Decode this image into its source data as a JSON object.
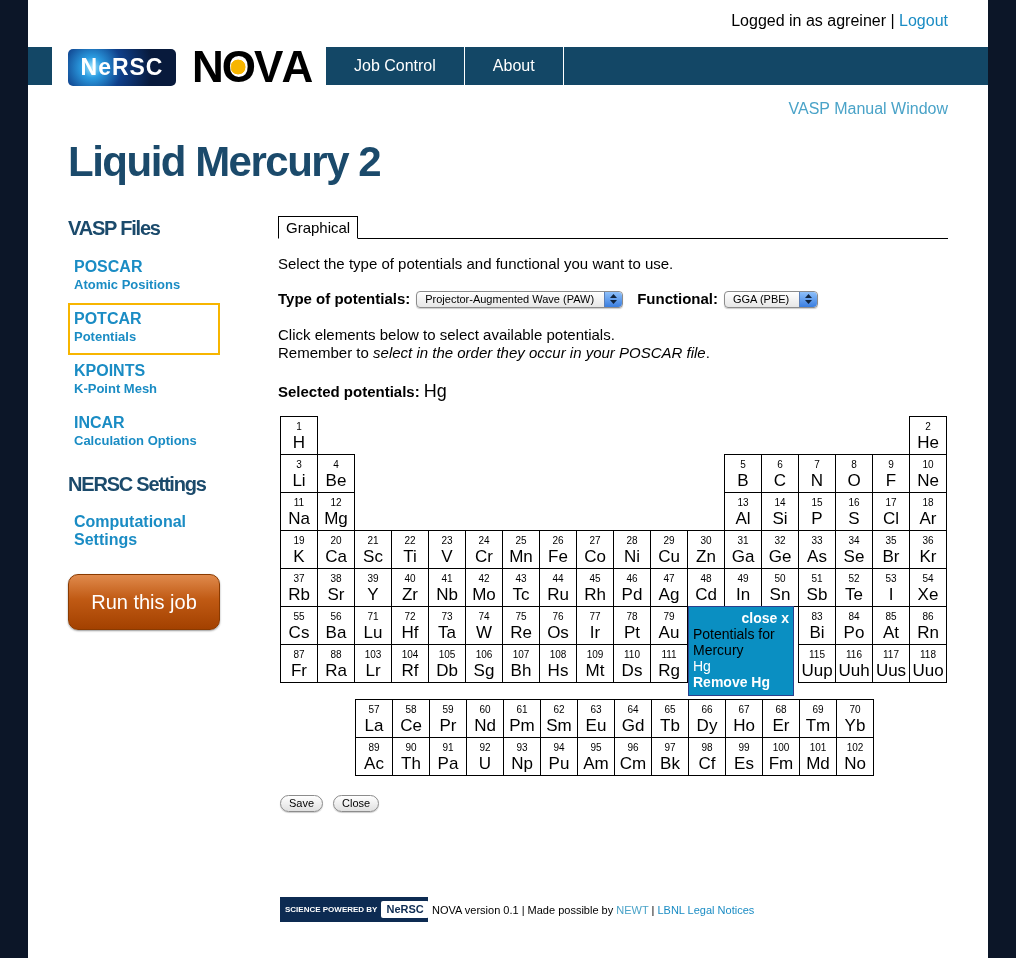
{
  "header": {
    "login_text": "Logged in as agreiner |",
    "logout": {
      "label": "Logout",
      "visited": false
    }
  },
  "logos": {
    "nersc": "NeRSC",
    "nova": "NOVA"
  },
  "nav": {
    "items": [
      {
        "label": "Job Control"
      },
      {
        "label": "About"
      }
    ]
  },
  "manual_link": {
    "label": "VASP Manual Window",
    "visited": true
  },
  "page_title": "Liquid Mercury 2",
  "sidebar": {
    "sections": [
      {
        "heading": "VASP Files",
        "items": [
          {
            "title": "POSCAR",
            "subtitle": "Atomic Positions",
            "selected": false
          },
          {
            "title": "POTCAR",
            "subtitle": "Potentials",
            "selected": true
          },
          {
            "title": "KPOINTS",
            "subtitle": "K-Point Mesh",
            "selected": false
          },
          {
            "title": "INCAR",
            "subtitle": "Calculation Options",
            "selected": false
          }
        ]
      },
      {
        "heading": "NERSC Settings",
        "items": [
          {
            "title": "Computational Settings",
            "selected": false
          }
        ]
      }
    ],
    "run_button": "Run this job"
  },
  "tabs": [
    {
      "label": "Graphical",
      "selected": true
    }
  ],
  "intro": "Select the type of potentials and functional you want to use.",
  "selects": [
    {
      "label": "Type of potentials:",
      "value": "Projector-Augmented Wave (PAW)"
    },
    {
      "label": "Functional:",
      "value": "GGA (PBE)"
    }
  ],
  "instructions": [
    "Click elements below to select available potentials.",
    "Remember to *select in the order they occur in your POSCAR file*."
  ],
  "selected_potentials": {
    "label": "Selected potentials:",
    "value": "Hg"
  },
  "periodic_table": {
    "main_rows": [
      [
        {
          "number": "1",
          "symbol": "H"
        },
        null,
        null,
        null,
        null,
        null,
        null,
        null,
        null,
        null,
        null,
        null,
        null,
        null,
        null,
        null,
        null,
        {
          "number": "2",
          "symbol": "He"
        }
      ],
      [
        {
          "number": "3",
          "symbol": "Li"
        },
        {
          "number": "4",
          "symbol": "Be"
        },
        null,
        null,
        null,
        null,
        null,
        null,
        null,
        null,
        null,
        null,
        {
          "number": "5",
          "symbol": "B"
        },
        {
          "number": "6",
          "symbol": "C"
        },
        {
          "number": "7",
          "symbol": "N"
        },
        {
          "number": "8",
          "symbol": "O"
        },
        {
          "number": "9",
          "symbol": "F"
        },
        {
          "number": "10",
          "symbol": "Ne"
        }
      ],
      [
        {
          "number": "11",
          "symbol": "Na"
        },
        {
          "number": "12",
          "symbol": "Mg"
        },
        null,
        null,
        null,
        null,
        null,
        null,
        null,
        null,
        null,
        null,
        {
          "number": "13",
          "symbol": "Al"
        },
        {
          "number": "14",
          "symbol": "Si"
        },
        {
          "number": "15",
          "symbol": "P"
        },
        {
          "number": "16",
          "symbol": "S"
        },
        {
          "number": "17",
          "symbol": "Cl"
        },
        {
          "number": "18",
          "symbol": "Ar"
        }
      ],
      [
        {
          "number": "19",
          "symbol": "K"
        },
        {
          "number": "20",
          "symbol": "Ca"
        },
        {
          "number": "21",
          "symbol": "Sc"
        },
        {
          "number": "22",
          "symbol": "Ti"
        },
        {
          "number": "23",
          "symbol": "V"
        },
        {
          "number": "24",
          "symbol": "Cr"
        },
        {
          "number": "25",
          "symbol": "Mn"
        },
        {
          "number": "26",
          "symbol": "Fe"
        },
        {
          "number": "27",
          "symbol": "Co"
        },
        {
          "number": "28",
          "symbol": "Ni"
        },
        {
          "number": "29",
          "symbol": "Cu"
        },
        {
          "number": "30",
          "symbol": "Zn"
        },
        {
          "number": "31",
          "symbol": "Ga"
        },
        {
          "number": "32",
          "symbol": "Ge"
        },
        {
          "number": "33",
          "symbol": "As"
        },
        {
          "number": "34",
          "symbol": "Se"
        },
        {
          "number": "35",
          "symbol": "Br"
        },
        {
          "number": "36",
          "symbol": "Kr"
        }
      ],
      [
        {
          "number": "37",
          "symbol": "Rb"
        },
        {
          "number": "38",
          "symbol": "Sr"
        },
        {
          "number": "39",
          "symbol": "Y"
        },
        {
          "number": "40",
          "symbol": "Zr"
        },
        {
          "number": "41",
          "symbol": "Nb"
        },
        {
          "number": "42",
          "symbol": "Mo"
        },
        {
          "number": "43",
          "symbol": "Tc"
        },
        {
          "number": "44",
          "symbol": "Ru"
        },
        {
          "number": "45",
          "symbol": "Rh"
        },
        {
          "number": "46",
          "symbol": "Pd"
        },
        {
          "number": "47",
          "symbol": "Ag"
        },
        {
          "number": "48",
          "symbol": "Cd"
        },
        {
          "number": "49",
          "symbol": "In"
        },
        {
          "number": "50",
          "symbol": "Sn"
        },
        {
          "number": "51",
          "symbol": "Sb"
        },
        {
          "number": "52",
          "symbol": "Te"
        },
        {
          "number": "53",
          "symbol": "I"
        },
        {
          "number": "54",
          "symbol": "Xe"
        }
      ],
      [
        {
          "number": "55",
          "symbol": "Cs"
        },
        {
          "number": "56",
          "symbol": "Ba"
        },
        {
          "number": "71",
          "symbol": "Lu"
        },
        {
          "number": "72",
          "symbol": "Hf"
        },
        {
          "number": "73",
          "symbol": "Ta"
        },
        {
          "number": "74",
          "symbol": "W"
        },
        {
          "number": "75",
          "symbol": "Re"
        },
        {
          "number": "76",
          "symbol": "Os"
        },
        {
          "number": "77",
          "symbol": "Ir"
        },
        {
          "number": "78",
          "symbol": "Pt"
        },
        {
          "number": "79",
          "symbol": "Au"
        },
        null,
        null,
        null,
        {
          "number": "83",
          "symbol": "Bi"
        },
        {
          "number": "84",
          "symbol": "Po"
        },
        {
          "number": "85",
          "symbol": "At"
        },
        {
          "number": "86",
          "symbol": "Rn"
        }
      ],
      [
        {
          "number": "87",
          "symbol": "Fr"
        },
        {
          "number": "88",
          "symbol": "Ra"
        },
        {
          "number": "103",
          "symbol": "Lr"
        },
        {
          "number": "104",
          "symbol": "Rf"
        },
        {
          "number": "105",
          "symbol": "Db"
        },
        {
          "number": "106",
          "symbol": "Sg"
        },
        {
          "number": "107",
          "symbol": "Bh"
        },
        {
          "number": "108",
          "symbol": "Hs"
        },
        {
          "number": "109",
          "symbol": "Mt"
        },
        {
          "number": "110",
          "symbol": "Ds"
        },
        {
          "number": "111",
          "symbol": "Rg"
        },
        null,
        null,
        null,
        {
          "number": "115",
          "symbol": "Uup"
        },
        {
          "number": "116",
          "symbol": "Uuh"
        },
        {
          "number": "117",
          "symbol": "Uus"
        },
        {
          "number": "118",
          "symbol": "Uuo"
        }
      ]
    ],
    "f_block_rows": [
      [
        {
          "number": "57",
          "symbol": "La"
        },
        {
          "number": "58",
          "symbol": "Ce"
        },
        {
          "number": "59",
          "symbol": "Pr"
        },
        {
          "number": "60",
          "symbol": "Nd"
        },
        {
          "number": "61",
          "symbol": "Pm"
        },
        {
          "number": "62",
          "symbol": "Sm"
        },
        {
          "number": "63",
          "symbol": "Eu"
        },
        {
          "number": "64",
          "symbol": "Gd"
        },
        {
          "number": "65",
          "symbol": "Tb"
        },
        {
          "number": "66",
          "symbol": "Dy"
        },
        {
          "number": "67",
          "symbol": "Ho"
        },
        {
          "number": "68",
          "symbol": "Er"
        },
        {
          "number": "69",
          "symbol": "Tm"
        },
        {
          "number": "70",
          "symbol": "Yb"
        }
      ],
      [
        {
          "number": "89",
          "symbol": "Ac"
        },
        {
          "number": "90",
          "symbol": "Th"
        },
        {
          "number": "91",
          "symbol": "Pa"
        },
        {
          "number": "92",
          "symbol": "U"
        },
        {
          "number": "93",
          "symbol": "Np"
        },
        {
          "number": "94",
          "symbol": "Pu"
        },
        {
          "number": "95",
          "symbol": "Am"
        },
        {
          "number": "96",
          "symbol": "Cm"
        },
        {
          "number": "97",
          "symbol": "Bk"
        },
        {
          "number": "98",
          "symbol": "Cf"
        },
        {
          "number": "99",
          "symbol": "Es"
        },
        {
          "number": "100",
          "symbol": "Fm"
        },
        {
          "number": "101",
          "symbol": "Md"
        },
        {
          "number": "102",
          "symbol": "No"
        }
      ]
    ]
  },
  "popup": {
    "close_label": "close x",
    "title": "Potentials for Mercury",
    "options": [
      {
        "label": "Hg"
      }
    ],
    "remove_label": "Remove Hg"
  },
  "buttons": [
    "Save",
    "Close"
  ],
  "footer": {
    "badge": {
      "label": "SCIENCE POWERED BY",
      "logo": "NeRSC"
    },
    "parts": [
      {
        "kind": "text",
        "text": "NOVA version 0.1 | Made possible by"
      },
      {
        "kind": "link",
        "text": "NEWT",
        "visited": true
      },
      {
        "kind": "text",
        "text": "|"
      },
      {
        "kind": "link",
        "text": "LBNL Legal Notices",
        "visited": false
      }
    ]
  }
}
